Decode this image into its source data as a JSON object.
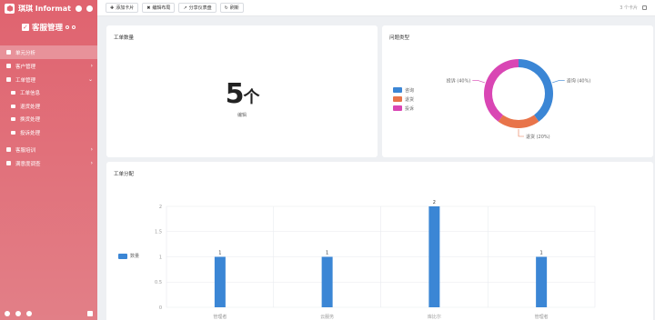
{
  "sidebar": {
    "brand": "琪琪 Informat",
    "app_title": "客服管理",
    "menu": [
      {
        "label": "单元分析",
        "active": true,
        "icon": "chart-icon",
        "expandable": false
      },
      {
        "label": "客户管理",
        "active": false,
        "icon": "users-icon",
        "expandable": true
      },
      {
        "label": "工单管理",
        "active": false,
        "icon": "ticket-icon",
        "expandable": true,
        "expanded": true
      }
    ],
    "submenu": [
      {
        "label": "工单信息",
        "icon": "doc-icon"
      },
      {
        "label": "退货处理",
        "icon": "return-icon"
      },
      {
        "label": "换货处理",
        "icon": "exchange-icon"
      },
      {
        "label": "投诉处理",
        "icon": "complaint-icon"
      }
    ],
    "menu_after": [
      {
        "label": "客服培训",
        "icon": "book-icon",
        "expandable": true
      },
      {
        "label": "满意度调查",
        "icon": "calendar-icon",
        "expandable": true
      }
    ]
  },
  "toolbar": {
    "add_card": "添加卡片",
    "edit_layout": "编辑布局",
    "share": "分享仪表盘",
    "refresh": "刷新",
    "card_count": "3 个卡片"
  },
  "cards": {
    "ticket_count": {
      "title": "工单数量",
      "value": "5",
      "unit": "个",
      "label": "编辑"
    },
    "issue_type": {
      "title": "问题类型"
    },
    "ticket_dist": {
      "title": "工单分配"
    }
  },
  "colors": {
    "blue": "#3b86d5",
    "orange": "#e8744a",
    "magenta": "#d946b4",
    "sidebar": "#e0636f"
  },
  "chart_data": [
    {
      "type": "pie",
      "title": "问题类型",
      "categories": [
        "咨询",
        "退货",
        "投诉"
      ],
      "values": [
        40,
        20,
        40
      ],
      "labels": [
        "咨询 (40%)",
        "退货 (20%)",
        "投诉 (40%)"
      ],
      "colors": [
        "#3b86d5",
        "#e8744a",
        "#d946b4"
      ],
      "legend": "left"
    },
    {
      "type": "bar",
      "title": "工单分配",
      "categories": [
        "管理者",
        "云服务",
        "库比尔",
        "管理者"
      ],
      "series": [
        {
          "name": "数量",
          "values": [
            1,
            1,
            2,
            1
          ]
        }
      ],
      "ylim": [
        0,
        2
      ],
      "yticks": [
        "0",
        "0.5",
        "1",
        "1.5",
        "2"
      ],
      "grid": true,
      "legend": "left"
    }
  ]
}
